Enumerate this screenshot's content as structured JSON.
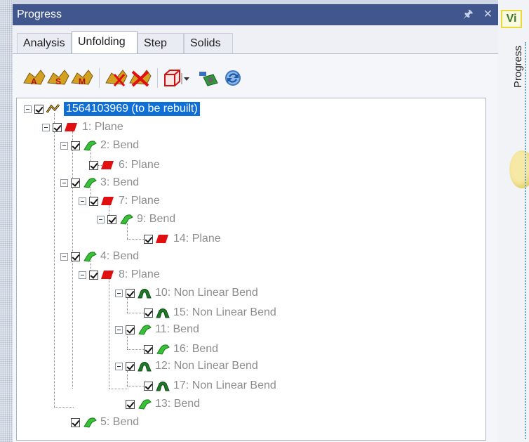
{
  "panel": {
    "title": "Progress",
    "pin_icon": "pin-icon",
    "close_icon": "close-icon",
    "tabs": [
      {
        "label": "Analysis",
        "active": false
      },
      {
        "label": "Unfolding",
        "active": true
      },
      {
        "label": "Step",
        "active": false
      },
      {
        "label": "Solids",
        "active": false
      }
    ]
  },
  "toolbar": {
    "icons": [
      "unfold-a-icon",
      "unfold-s-icon",
      "unfold-m-icon",
      "tag-remove-icon",
      "delete-x-icon",
      "red-cube-icon",
      "dropdown-arrow-icon",
      "recompute-gear-icon",
      "refresh-icon"
    ]
  },
  "tree": {
    "nodes": [
      {
        "label": "1564103969 (to be rebuilt)",
        "icon": "part-icon",
        "selected": true
      },
      {
        "label": "1: Plane",
        "icon": "plane-icon"
      },
      {
        "label": "2: Bend",
        "icon": "bend-icon"
      },
      {
        "label": "6: Plane",
        "icon": "plane-icon"
      },
      {
        "label": "3: Bend",
        "icon": "bend-icon"
      },
      {
        "label": "7: Plane",
        "icon": "plane-icon"
      },
      {
        "label": "9: Bend",
        "icon": "bend-icon"
      },
      {
        "label": "14: Plane",
        "icon": "plane-icon"
      },
      {
        "label": "4: Bend",
        "icon": "bend-icon"
      },
      {
        "label": "8: Plane",
        "icon": "plane-icon"
      },
      {
        "label": "10: Non Linear Bend",
        "icon": "nonlinear-bend-icon"
      },
      {
        "label": "15: Non Linear Bend",
        "icon": "nonlinear-bend-icon"
      },
      {
        "label": "11: Bend",
        "icon": "bend-icon"
      },
      {
        "label": "16: Bend",
        "icon": "bend-icon"
      },
      {
        "label": "12: Non Linear Bend",
        "icon": "nonlinear-bend-icon"
      },
      {
        "label": "17: Non Linear Bend",
        "icon": "nonlinear-bend-icon"
      },
      {
        "label": "13: Bend",
        "icon": "bend-icon"
      },
      {
        "label": "5: Bend",
        "icon": "bend-icon"
      }
    ]
  },
  "side": {
    "badge": "Vi",
    "progress_label": "Progress"
  },
  "colors": {
    "title_bar": "#40568d",
    "selection": "#0f6fd6",
    "plane": "#e01010",
    "bend": "#38c038",
    "nonlinear_bend": "#1f7a2a",
    "label_gray": "#8d8d8d"
  }
}
